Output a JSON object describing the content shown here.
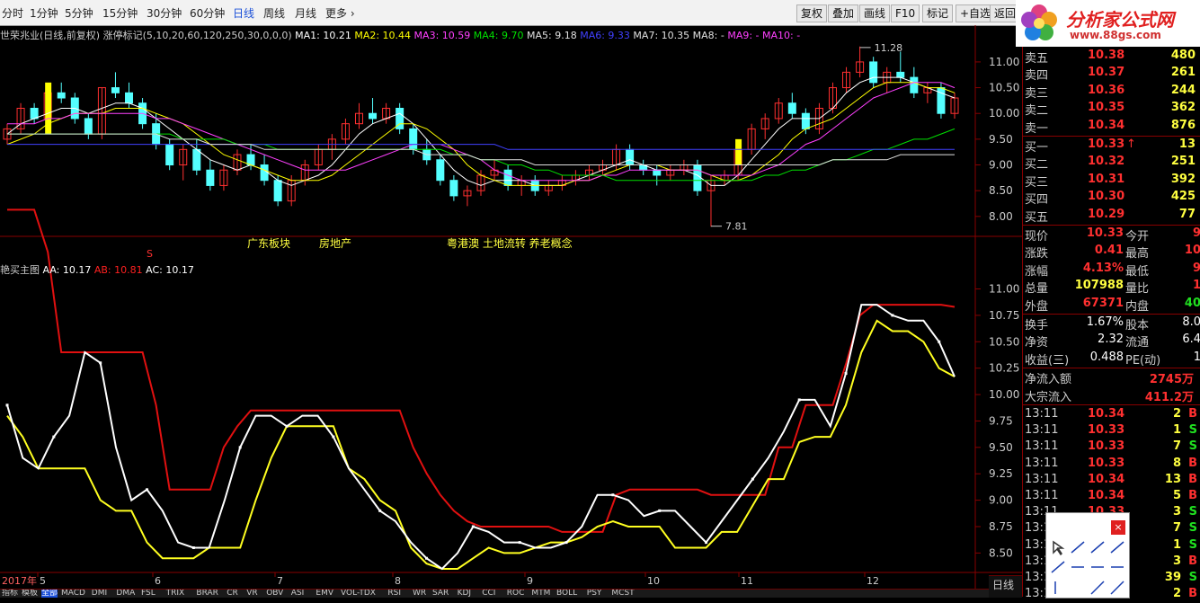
{
  "toolbar": {
    "periods": [
      "分时",
      "1分钟",
      "5分钟",
      "15分钟",
      "30分钟",
      "60分钟",
      "日线",
      "周线",
      "月线",
      "更多"
    ],
    "active_period": "日线",
    "buttons": [
      "复权",
      "叠加",
      "画线",
      "F10",
      "标记",
      "+自选",
      "返回"
    ]
  },
  "logo": {
    "name": "分析家公式网",
    "url": "www.88gs.com"
  },
  "upper_chart": {
    "title": "世荣兆业(日线,前复权)",
    "indicator": "涨停标记(5,10,20,60,120,250,30,0,0,0)",
    "ma_labels": [
      {
        "text": "MA1: 10.21",
        "color": "#ffffff"
      },
      {
        "text": "MA2: 10.44",
        "color": "#ffff00"
      },
      {
        "text": "MA3: 10.59",
        "color": "#ff40ff"
      },
      {
        "text": "MA4: 9.70",
        "color": "#00e000"
      },
      {
        "text": "MA5: 9.18",
        "color": "#e0e0e0"
      },
      {
        "text": "MA6: 9.33",
        "color": "#4040ff"
      },
      {
        "text": "MA7: 10.35",
        "color": "#e0e0e0"
      },
      {
        "text": "MA8: -",
        "color": "#e0e0e0"
      },
      {
        "text": "MA9: -",
        "color": "#ff40ff"
      },
      {
        "text": "MA10: -",
        "color": "#ff40ff"
      }
    ],
    "y_ticks": [
      "11.00",
      "10.50",
      "10.00",
      "9.50",
      "9.00",
      "8.50",
      "8.00"
    ],
    "high_label": "11.28",
    "low_label": "7.81",
    "annotations": [
      "广东板块",
      "房地产",
      "粤港澳 土地流转 养老概念"
    ],
    "s_marker": "S",
    "candles": [
      [
        9.5,
        9.8,
        9.4,
        9.7
      ],
      [
        9.7,
        10.2,
        9.6,
        10.1
      ],
      [
        10.1,
        10.2,
        9.8,
        9.9
      ],
      [
        9.9,
        10.5,
        9.8,
        10.4
      ],
      [
        10.4,
        10.6,
        10.2,
        10.3
      ],
      [
        10.3,
        10.4,
        9.8,
        9.9
      ],
      [
        9.9,
        10.0,
        9.5,
        9.6
      ],
      [
        9.6,
        10.5,
        9.5,
        10.5
      ],
      [
        10.5,
        10.8,
        10.3,
        10.4
      ],
      [
        10.4,
        10.6,
        10.1,
        10.2
      ],
      [
        10.2,
        10.3,
        9.7,
        9.8
      ],
      [
        9.8,
        10.0,
        9.3,
        9.4
      ],
      [
        9.4,
        9.5,
        8.9,
        9.0
      ],
      [
        9.0,
        9.4,
        8.7,
        9.3
      ],
      [
        9.3,
        9.5,
        8.8,
        8.9
      ],
      [
        8.9,
        9.1,
        8.5,
        8.6
      ],
      [
        8.6,
        9.0,
        8.5,
        8.9
      ],
      [
        8.9,
        9.3,
        8.8,
        9.2
      ],
      [
        9.2,
        9.4,
        8.9,
        9.0
      ],
      [
        9.0,
        9.2,
        8.6,
        8.7
      ],
      [
        8.7,
        8.8,
        8.2,
        8.3
      ],
      [
        8.3,
        8.8,
        8.2,
        8.7
      ],
      [
        8.7,
        9.1,
        8.6,
        9.0
      ],
      [
        9.0,
        9.4,
        8.9,
        9.3
      ],
      [
        9.3,
        9.6,
        9.1,
        9.5
      ],
      [
        9.5,
        9.9,
        9.4,
        9.8
      ],
      [
        9.8,
        10.2,
        9.7,
        10.0
      ],
      [
        10.0,
        10.3,
        9.8,
        9.9
      ],
      [
        9.9,
        10.2,
        9.8,
        10.1
      ],
      [
        10.1,
        10.2,
        9.6,
        9.7
      ],
      [
        9.7,
        9.8,
        9.2,
        9.3
      ],
      [
        9.3,
        9.5,
        9.0,
        9.1
      ],
      [
        9.1,
        9.2,
        8.6,
        8.7
      ],
      [
        8.7,
        8.8,
        8.3,
        8.4
      ],
      [
        8.4,
        8.6,
        8.2,
        8.5
      ],
      [
        8.5,
        8.9,
        8.4,
        8.8
      ],
      [
        8.8,
        9.1,
        8.7,
        8.9
      ],
      [
        8.9,
        9.0,
        8.5,
        8.6
      ],
      [
        8.6,
        8.8,
        8.4,
        8.7
      ],
      [
        8.7,
        8.8,
        8.4,
        8.5
      ],
      [
        8.5,
        8.7,
        8.4,
        8.6
      ],
      [
        8.6,
        8.8,
        8.5,
        8.7
      ],
      [
        8.7,
        8.9,
        8.6,
        8.8
      ],
      [
        8.8,
        9.0,
        8.7,
        8.9
      ],
      [
        8.9,
        9.1,
        8.8,
        9.0
      ],
      [
        9.0,
        9.4,
        8.9,
        9.3
      ],
      [
        9.3,
        9.4,
        8.9,
        9.0
      ],
      [
        9.0,
        9.1,
        8.8,
        8.9
      ],
      [
        8.9,
        9.0,
        8.6,
        8.8
      ],
      [
        8.8,
        9.0,
        8.7,
        8.9
      ],
      [
        8.9,
        9.1,
        8.8,
        9.0
      ],
      [
        9.0,
        9.1,
        8.4,
        8.5
      ],
      [
        8.5,
        8.8,
        7.8,
        8.7
      ],
      [
        8.7,
        8.9,
        8.6,
        8.8
      ],
      [
        8.8,
        9.4,
        8.7,
        9.3
      ],
      [
        9.3,
        9.8,
        9.2,
        9.7
      ],
      [
        9.7,
        10.0,
        9.5,
        9.9
      ],
      [
        9.9,
        10.3,
        9.8,
        10.2
      ],
      [
        10.2,
        10.4,
        9.9,
        10.0
      ],
      [
        10.0,
        10.1,
        9.6,
        9.7
      ],
      [
        9.7,
        10.2,
        9.6,
        10.1
      ],
      [
        10.1,
        10.6,
        10.0,
        10.5
      ],
      [
        10.5,
        10.9,
        10.4,
        10.8
      ],
      [
        10.8,
        11.3,
        10.7,
        11.0
      ],
      [
        11.0,
        11.1,
        10.5,
        10.6
      ],
      [
        10.6,
        10.9,
        10.4,
        10.8
      ],
      [
        10.8,
        11.2,
        10.6,
        10.7
      ],
      [
        10.7,
        10.9,
        10.3,
        10.4
      ],
      [
        10.4,
        10.6,
        10.2,
        10.5
      ],
      [
        10.5,
        10.6,
        9.9,
        10.0
      ],
      [
        10.0,
        10.4,
        9.9,
        10.3
      ]
    ],
    "ma_lines": [
      {
        "color": "#ffffff",
        "values": [
          9.6,
          9.8,
          9.9,
          10.0,
          10.1,
          10.1,
          10.0,
          10.1,
          10.2,
          10.2,
          10.1,
          9.9,
          9.7,
          9.5,
          9.3,
          9.1,
          9.0,
          8.9,
          9.0,
          8.9,
          8.7,
          8.6,
          8.7,
          8.8,
          9.0,
          9.3,
          9.6,
          9.8,
          9.9,
          10.0,
          9.8,
          9.5,
          9.2,
          8.9,
          8.7,
          8.6,
          8.7,
          8.7,
          8.7,
          8.6,
          8.6,
          8.6,
          8.7,
          8.8,
          8.9,
          9.0,
          9.1,
          9.0,
          8.9,
          8.9,
          8.9,
          8.8,
          8.6,
          8.6,
          8.8,
          9.1,
          9.4,
          9.7,
          9.9,
          9.9,
          9.9,
          10.1,
          10.4,
          10.6,
          10.7,
          10.7,
          10.7,
          10.6,
          10.5,
          10.4,
          10.3
        ]
      },
      {
        "color": "#ffff00",
        "values": [
          9.4,
          9.5,
          9.6,
          9.8,
          9.9,
          10.0,
          10.0,
          10.0,
          10.1,
          10.1,
          10.1,
          10.0,
          9.9,
          9.8,
          9.6,
          9.4,
          9.2,
          9.1,
          9.0,
          8.9,
          8.8,
          8.7,
          8.7,
          8.7,
          8.8,
          9.0,
          9.2,
          9.4,
          9.6,
          9.8,
          9.8,
          9.7,
          9.5,
          9.3,
          9.0,
          8.8,
          8.7,
          8.6,
          8.6,
          8.6,
          8.6,
          8.6,
          8.7,
          8.7,
          8.8,
          8.9,
          9.0,
          9.0,
          9.0,
          8.9,
          8.9,
          8.9,
          8.8,
          8.7,
          8.7,
          8.8,
          9.0,
          9.2,
          9.5,
          9.7,
          9.8,
          9.9,
          10.1,
          10.3,
          10.5,
          10.6,
          10.6,
          10.6,
          10.5,
          10.5,
          10.4
        ]
      },
      {
        "color": "#ff40ff",
        "values": [
          9.8,
          9.8,
          9.8,
          9.9,
          9.9,
          10.0,
          10.0,
          10.0,
          10.0,
          10.0,
          10.0,
          9.9,
          9.9,
          9.8,
          9.7,
          9.6,
          9.5,
          9.4,
          9.3,
          9.2,
          9.1,
          9.0,
          8.9,
          8.9,
          8.9,
          8.9,
          9.0,
          9.1,
          9.2,
          9.3,
          9.4,
          9.4,
          9.4,
          9.3,
          9.2,
          9.1,
          8.9,
          8.8,
          8.7,
          8.7,
          8.7,
          8.7,
          8.7,
          8.7,
          8.8,
          8.8,
          8.9,
          8.9,
          8.9,
          8.9,
          8.9,
          8.9,
          8.8,
          8.8,
          8.8,
          8.8,
          8.9,
          9.0,
          9.2,
          9.4,
          9.5,
          9.7,
          9.9,
          10.1,
          10.3,
          10.4,
          10.5,
          10.6,
          10.6,
          10.6,
          10.5
        ]
      },
      {
        "color": "#00e000",
        "values": [
          9.6,
          9.6,
          9.6,
          9.6,
          9.6,
          9.6,
          9.6,
          9.6,
          9.6,
          9.6,
          9.6,
          9.6,
          9.6,
          9.5,
          9.5,
          9.5,
          9.5,
          9.4,
          9.4,
          9.4,
          9.3,
          9.3,
          9.3,
          9.3,
          9.3,
          9.3,
          9.3,
          9.3,
          9.3,
          9.3,
          9.3,
          9.3,
          9.3,
          9.2,
          9.2,
          9.1,
          9.1,
          9.0,
          9.0,
          8.9,
          8.9,
          8.8,
          8.8,
          8.8,
          8.8,
          8.7,
          8.7,
          8.7,
          8.7,
          8.7,
          8.7,
          8.7,
          8.7,
          8.7,
          8.7,
          8.7,
          8.8,
          8.8,
          8.9,
          8.9,
          9.0,
          9.1,
          9.1,
          9.2,
          9.3,
          9.3,
          9.4,
          9.5,
          9.5,
          9.6,
          9.7
        ]
      },
      {
        "color": "#4040ff",
        "values": [
          9.4,
          9.4,
          9.4,
          9.4,
          9.4,
          9.4,
          9.4,
          9.4,
          9.4,
          9.4,
          9.4,
          9.4,
          9.4,
          9.4,
          9.4,
          9.4,
          9.4,
          9.4,
          9.4,
          9.4,
          9.4,
          9.4,
          9.4,
          9.4,
          9.4,
          9.4,
          9.4,
          9.4,
          9.4,
          9.4,
          9.4,
          9.4,
          9.4,
          9.4,
          9.4,
          9.4,
          9.4,
          9.3,
          9.3,
          9.3,
          9.3,
          9.3,
          9.3,
          9.3,
          9.3,
          9.3,
          9.3,
          9.3,
          9.3,
          9.3,
          9.3,
          9.3,
          9.3,
          9.3,
          9.3,
          9.3,
          9.3,
          9.3,
          9.3,
          9.3,
          9.3,
          9.3,
          9.3,
          9.3,
          9.3,
          9.3,
          9.3,
          9.3,
          9.3,
          9.3,
          9.3
        ]
      },
      {
        "color": "#e0e0e0",
        "values": [
          9.6,
          9.6,
          9.6,
          9.6,
          9.6,
          9.6,
          9.6,
          9.6,
          9.6,
          9.6,
          9.6,
          9.6,
          9.5,
          9.5,
          9.5,
          9.4,
          9.4,
          9.4,
          9.4,
          9.3,
          9.3,
          9.3,
          9.3,
          9.3,
          9.3,
          9.3,
          9.3,
          9.3,
          9.3,
          9.3,
          9.3,
          9.2,
          9.2,
          9.2,
          9.2,
          9.1,
          9.1,
          9.1,
          9.1,
          9.0,
          9.0,
          9.0,
          9.0,
          9.0,
          9.0,
          9.0,
          9.0,
          9.0,
          9.0,
          9.0,
          9.0,
          9.0,
          9.0,
          9.0,
          9.0,
          9.0,
          9.0,
          9.0,
          9.0,
          9.0,
          9.0,
          9.1,
          9.1,
          9.1,
          9.1,
          9.1,
          9.2,
          9.2,
          9.2,
          9.2,
          9.2
        ]
      }
    ]
  },
  "lower_chart": {
    "title": "艳买主图",
    "labels": [
      {
        "text": "AA: 10.17",
        "color": "#ffffff"
      },
      {
        "text": "AB: 10.81",
        "color": "#ff2020"
      },
      {
        "text": "AC: 10.17",
        "color": "#ffffff"
      }
    ],
    "y_ticks": [
      "11.00",
      "10.75",
      "10.50",
      "10.25",
      "10.00",
      "9.75",
      "9.50",
      "9.25",
      "9.00",
      "8.75",
      "8.50"
    ],
    "red_line": [
      11.75,
      11.75,
      11.75,
      11.35,
      10.4,
      10.4,
      10.4,
      10.4,
      10.4,
      10.4,
      10.4,
      9.9,
      9.1,
      9.1,
      9.1,
      9.1,
      9.5,
      9.7,
      9.85,
      9.85,
      9.85,
      9.85,
      9.85,
      9.85,
      9.85,
      9.85,
      9.85,
      9.85,
      9.85,
      9.85,
      9.5,
      9.25,
      9.05,
      8.9,
      8.8,
      8.75,
      8.75,
      8.75,
      8.75,
      8.75,
      8.75,
      8.7,
      8.7,
      8.7,
      8.7,
      9.05,
      9.1,
      9.1,
      9.1,
      9.1,
      9.1,
      9.1,
      9.05,
      9.05,
      9.05,
      9.05,
      9.05,
      9.5,
      9.5,
      9.9,
      9.9,
      9.9,
      10.3,
      10.75,
      10.85,
      10.85,
      10.85,
      10.85,
      10.85,
      10.85,
      10.83
    ],
    "white_line": [
      9.9,
      9.4,
      9.3,
      9.6,
      9.8,
      10.4,
      10.3,
      9.5,
      9.0,
      9.1,
      8.9,
      8.6,
      8.55,
      8.55,
      9.0,
      9.5,
      9.8,
      9.8,
      9.7,
      9.8,
      9.8,
      9.6,
      9.3,
      9.1,
      8.9,
      8.8,
      8.6,
      8.45,
      8.35,
      8.5,
      8.75,
      8.7,
      8.6,
      8.6,
      8.55,
      8.55,
      8.6,
      8.75,
      9.05,
      9.05,
      9.0,
      8.85,
      8.9,
      8.9,
      8.75,
      8.6,
      8.8,
      9.0,
      9.2,
      9.4,
      9.65,
      9.95,
      9.95,
      9.7,
      10.2,
      10.85,
      10.85,
      10.75,
      10.7,
      10.7,
      10.5,
      10.17
    ],
    "yellow_line": [
      9.8,
      9.6,
      9.3,
      9.3,
      9.3,
      9.3,
      9.0,
      8.9,
      8.9,
      8.6,
      8.45,
      8.45,
      8.45,
      8.55,
      8.55,
      8.55,
      9.0,
      9.4,
      9.7,
      9.7,
      9.7,
      9.7,
      9.3,
      9.2,
      9.0,
      8.9,
      8.55,
      8.4,
      8.35,
      8.35,
      8.45,
      8.55,
      8.5,
      8.5,
      8.55,
      8.6,
      8.6,
      8.65,
      8.75,
      8.8,
      8.75,
      8.75,
      8.75,
      8.55,
      8.55,
      8.55,
      8.7,
      8.7,
      8.95,
      9.2,
      9.2,
      9.55,
      9.6,
      9.6,
      9.9,
      10.4,
      10.7,
      10.6,
      10.6,
      10.5,
      10.25,
      10.17
    ],
    "date_labels": [
      "2017年",
      "5",
      "6",
      "7",
      "8",
      "9",
      "10",
      "11",
      "12"
    ]
  },
  "bottom_tabs": [
    "指标",
    "模板",
    "全部",
    "MACD",
    "DMI",
    "DMA",
    "FSL",
    "TRIX",
    "BRAR",
    "CR",
    "VR",
    "OBV",
    "ASI",
    "EMV",
    "VOL-TDX",
    "RSI",
    "WR",
    "SAR",
    "KDJ",
    "CCI",
    "ROC",
    "MTM",
    "BOLL",
    "PSY",
    "MCST"
  ],
  "bottom_right_tab": "日线",
  "quote_panel": {
    "asks": [
      {
        "label": "卖五",
        "price": "10.38",
        "vol": "480"
      },
      {
        "label": "卖四",
        "price": "10.37",
        "vol": "261"
      },
      {
        "label": "卖三",
        "price": "10.36",
        "vol": "244"
      },
      {
        "label": "卖二",
        "price": "10.35",
        "vol": "362"
      },
      {
        "label": "卖一",
        "price": "10.34",
        "vol": "876"
      }
    ],
    "bids": [
      {
        "label": "买一",
        "price": "10.33",
        "arrow": "↑",
        "vol": "13"
      },
      {
        "label": "买二",
        "price": "10.32",
        "vol": "251"
      },
      {
        "label": "买三",
        "price": "10.31",
        "vol": "392"
      },
      {
        "label": "买四",
        "price": "10.30",
        "vol": "425"
      },
      {
        "label": "买五",
        "price": "10.29",
        "vol": "77"
      }
    ],
    "stats": [
      {
        "l1": "现价",
        "v1": "10.33",
        "l2": "今开",
        "v2": "9"
      },
      {
        "l1": "涨跌",
        "v1": "0.41",
        "l2": "最高",
        "v2": "10"
      },
      {
        "l1": "涨幅",
        "v1": "4.13%",
        "l2": "最低",
        "v2": "9"
      },
      {
        "l1": "总量",
        "v1": "107988",
        "l2": "量比",
        "v2": "1"
      },
      {
        "l1": "外盘",
        "v1": "67371",
        "l2": "内盘",
        "v2": "40"
      }
    ],
    "finance": [
      {
        "l1": "换手",
        "v1": "1.67%",
        "l2": "股本",
        "v2": "8.0"
      },
      {
        "l1": "净资",
        "v1": "2.32",
        "l2": "流通",
        "v2": "6.4"
      },
      {
        "l1": "收益(三)",
        "v1": "0.488",
        "l2": "PE(动)",
        "v2": "1"
      }
    ],
    "flow": [
      {
        "label": "净流入额",
        "value": "2745万"
      },
      {
        "label": "大宗流入",
        "value": "411.2万"
      }
    ],
    "ticks": [
      {
        "time": "13:11",
        "price": "10.34",
        "vol": "2",
        "side": "B"
      },
      {
        "time": "13:11",
        "price": "10.33",
        "vol": "1",
        "side": "S"
      },
      {
        "time": "13:11",
        "price": "10.33",
        "vol": "7",
        "side": "S"
      },
      {
        "time": "13:11",
        "price": "10.33",
        "vol": "8",
        "side": "B"
      },
      {
        "time": "13:11",
        "price": "10.34",
        "vol": "13",
        "side": "B"
      },
      {
        "time": "13:11",
        "price": "10.34",
        "vol": "5",
        "side": "B"
      },
      {
        "time": "13:11",
        "price": "10.33",
        "vol": "3",
        "side": "S"
      },
      {
        "time": "13:11",
        "price": "",
        "vol": "7",
        "side": "S"
      },
      {
        "time": "13:11",
        "price": "",
        "vol": "1",
        "side": "S"
      },
      {
        "time": "13:11",
        "price": "",
        "vol": "3",
        "side": "B"
      },
      {
        "time": "13:11",
        "price": "",
        "vol": "39",
        "side": "S"
      },
      {
        "time": "13:11",
        "price": "",
        "vol": "2",
        "side": "B"
      }
    ]
  },
  "tool_popup": {
    "close_label": "×"
  }
}
